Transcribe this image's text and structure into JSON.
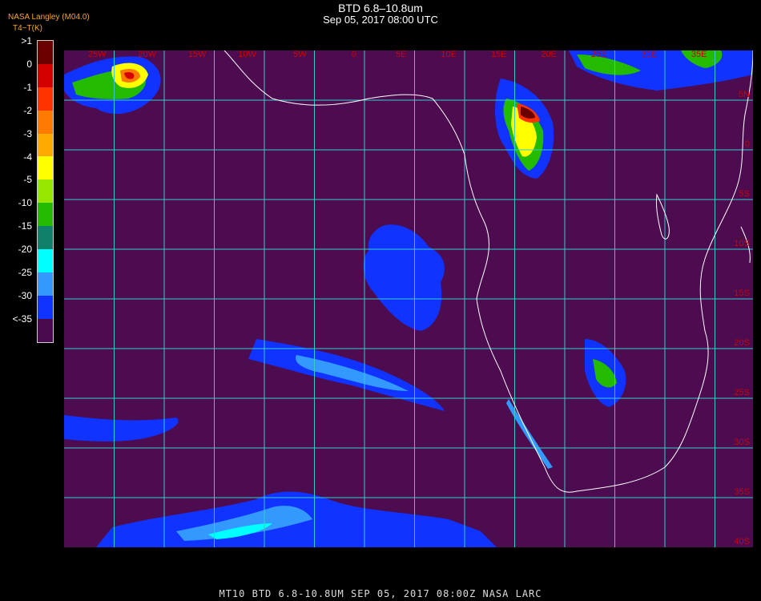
{
  "header": {
    "title": "BTD 6.8–10.8um",
    "datetime": "Sep 05, 2017 08:00 UTC",
    "credit": "NASA Langley (M04.0)",
    "unit": "T4−T(K)"
  },
  "legend": {
    "labels": [
      ">1",
      "0",
      "-1",
      "-2",
      "-3",
      "-4",
      "-5",
      "-10",
      "-15",
      "-20",
      "-25",
      "-30",
      "<-35"
    ],
    "colors": [
      "#6a0000",
      "#d40000",
      "#ff3300",
      "#ff7a00",
      "#ffaa00",
      "#ffff00",
      "#99e600",
      "#22bb00",
      "#11806a",
      "#00ffff",
      "#3399ff",
      "#1133ff",
      "#4a0a4f"
    ]
  },
  "map": {
    "background_color": "#4d0b50",
    "grid_color": "#33cccc",
    "coast_color": "#ffffff",
    "top_lon_labels": [
      "25W",
      "20W",
      "15W",
      "10W",
      "5W",
      "0",
      "5E",
      "10E",
      "15E",
      "20E",
      "25E",
      "30E",
      "35E"
    ],
    "right_lat_labels": [
      "5N",
      "0",
      "5S",
      "10S",
      "15S",
      "20S",
      "25S",
      "30S",
      "35S",
      "40S"
    ],
    "label_color": "#cc0000"
  },
  "footer": "MT10   BTD 6.8-10.8UM   SEP 05, 2017 08:00Z   NASA LARC"
}
